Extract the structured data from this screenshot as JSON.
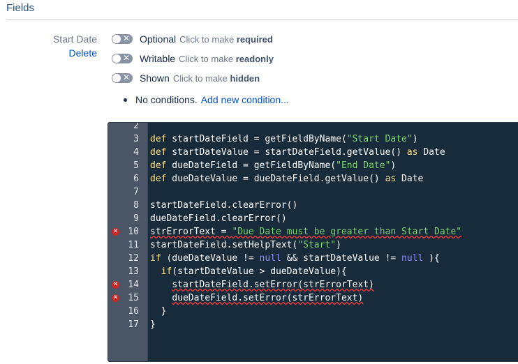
{
  "section": {
    "title": "Fields"
  },
  "field": {
    "name": "Start Date",
    "delete_label": "Delete"
  },
  "toggles": [
    {
      "state": "Optional",
      "hint": "Click to make",
      "action": "required",
      "on": false
    },
    {
      "state": "Writable",
      "hint": "Click to make",
      "action": "readonly",
      "on": false
    },
    {
      "state": "Shown",
      "hint": "Click to make",
      "action": "hidden",
      "on": false
    }
  ],
  "conditions": {
    "text": "No conditions.",
    "link": "Add new condition..."
  },
  "editor": {
    "lines": [
      {
        "n": "2",
        "code": "",
        "error": false
      },
      {
        "n": "3",
        "code": "def startDateField = getFieldByName(\"Start Date\")",
        "error": false
      },
      {
        "n": "4",
        "code": "def startDateValue = startDateField.getValue() as Date",
        "error": false
      },
      {
        "n": "5",
        "code": "def dueDateField = getFieldByName(\"End Date\")",
        "error": false
      },
      {
        "n": "6",
        "code": "def dueDateValue = dueDateField.getValue() as Date",
        "error": false
      },
      {
        "n": "7",
        "code": "",
        "error": false
      },
      {
        "n": "8",
        "code": "startDateField.clearError()",
        "error": false
      },
      {
        "n": "9",
        "code": "dueDateField.clearError()",
        "error": false
      },
      {
        "n": "10",
        "code": "strErrorText = \"Due Date must be greater than Start Date\"",
        "error": true
      },
      {
        "n": "11",
        "code": "startDateField.setHelpText(\"Start\")",
        "error": false
      },
      {
        "n": "12",
        "code": "if (dueDateValue != null && startDateValue != null ){",
        "error": false
      },
      {
        "n": "13",
        "code": "  if(startDateValue > dueDateValue){",
        "error": false
      },
      {
        "n": "14",
        "code": "    startDateField.setError(strErrorText)",
        "error": true
      },
      {
        "n": "15",
        "code": "    dueDateField.setError(strErrorText)",
        "error": true
      },
      {
        "n": "16",
        "code": "  }",
        "error": false
      },
      {
        "n": "17",
        "code": "}",
        "error": false
      }
    ]
  }
}
